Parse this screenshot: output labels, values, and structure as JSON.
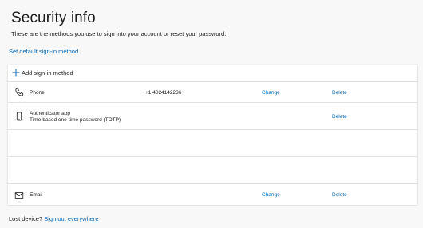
{
  "header": {
    "title": "Security info",
    "subtitle": "These are the methods you use to sign into your account or reset your password.",
    "default_link": "Set default sign-in method"
  },
  "methods": {
    "add_label": "Add sign-in method",
    "phone": {
      "name": "Phone",
      "value": "+1 4024142236",
      "change": "Change",
      "delete": "Delete"
    },
    "authenticator": {
      "name": "Authenticator app",
      "sub": "Time-based one-time password (TOTP)",
      "delete": "Delete"
    },
    "email": {
      "name": "Email",
      "change": "Change",
      "delete": "Delete"
    }
  },
  "footer": {
    "lost_prefix": "Lost device?",
    "lost_link": "Sign out everywhere"
  },
  "colors": {
    "link": "#0067b8",
    "text": "#1b1b1b",
    "background": "#f8f8f8",
    "card": "#ffffff",
    "divider": "#e1e1e1"
  },
  "icons": [
    "plus-icon",
    "phone-icon",
    "mobile-device-icon",
    "mail-icon"
  ]
}
